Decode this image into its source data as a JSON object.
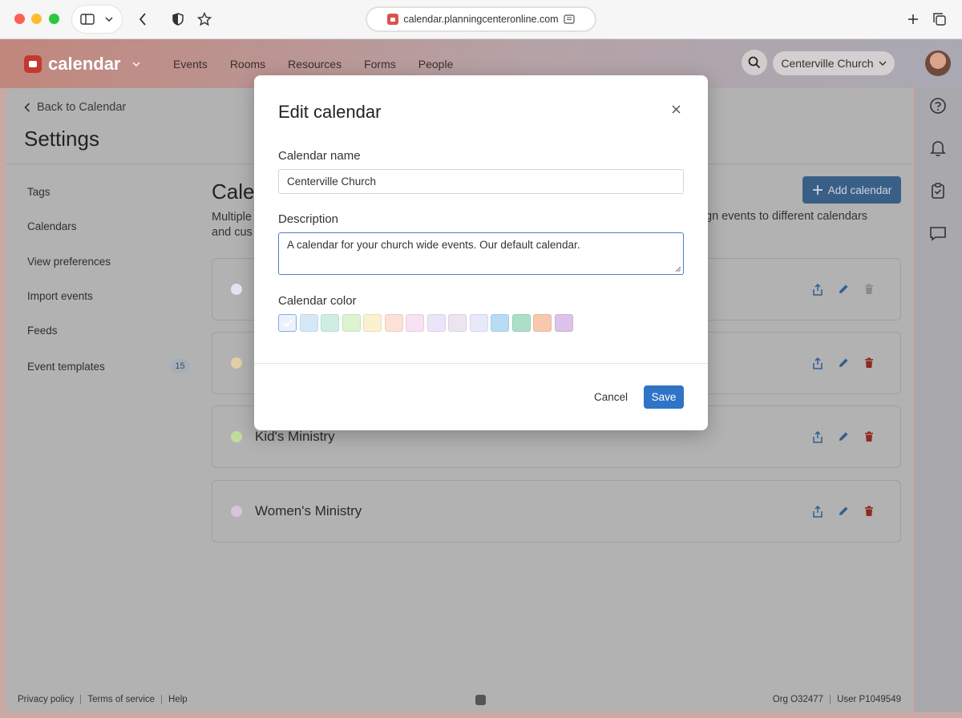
{
  "browser": {
    "url": "calendar.planningcenteronline.com"
  },
  "app": {
    "brand": "calendar",
    "nav": [
      "Events",
      "Rooms",
      "Resources",
      "Forms",
      "People"
    ],
    "org": "Centerville Church"
  },
  "settings": {
    "back_label": "Back to Calendar",
    "title": "Settings",
    "sidebar": [
      {
        "label": "Tags"
      },
      {
        "label": "Calendars"
      },
      {
        "label": "View preferences"
      },
      {
        "label": "Import events"
      },
      {
        "label": "Feeds"
      },
      {
        "label": "Event templates",
        "count": "15"
      }
    ]
  },
  "calendars": {
    "title_partial": "Cale",
    "desc_line1_partial": "Multiple",
    "desc_line2_partial": "and cus",
    "desc_right_partial": "gn events to different calendars",
    "add_label": "Add calendar",
    "items": [
      {
        "name": "",
        "color": "#e3e4f1"
      },
      {
        "name": "",
        "color": "#e3cfa4"
      },
      {
        "name": "Kid's Ministry",
        "color": "#bedd9f"
      },
      {
        "name": "Women's Ministry",
        "color": "#d7c4d9"
      }
    ]
  },
  "footer": {
    "privacy": "Privacy policy",
    "terms": "Terms of service",
    "help": "Help",
    "org_id": "Org O32477",
    "user_id": "User P1049549"
  },
  "modal": {
    "title": "Edit calendar",
    "name_label": "Calendar name",
    "name_value": "Centerville Church",
    "description_label": "Description",
    "description_value": "A calendar for your church wide events. Our default calendar.",
    "color_label": "Calendar color",
    "selected_color_index": 0,
    "colors": [
      "#eef1fb",
      "#d5e8f8",
      "#cfeee3",
      "#def3cf",
      "#fbf1cf",
      "#fde0d6",
      "#f7e1f3",
      "#ece4f8",
      "#ece4ef",
      "#e8e8fb",
      "#b8dcf5",
      "#abdfc8",
      "#f8c8ad",
      "#dcc3e9"
    ],
    "cancel_label": "Cancel",
    "save_label": "Save"
  },
  "colors": {
    "primary": "#2f74c7",
    "danger": "#c0392b",
    "brand": "#c4392f"
  }
}
